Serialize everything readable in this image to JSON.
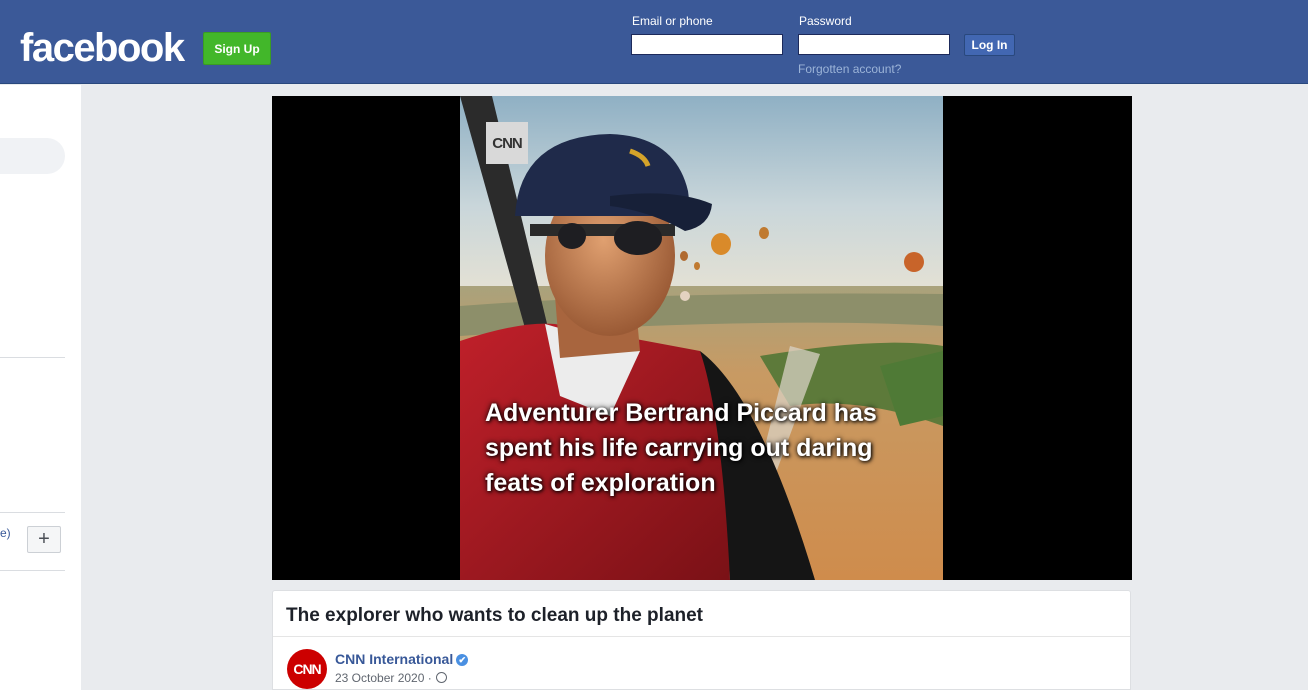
{
  "header": {
    "logo_text": "facebook",
    "signup_label": "Sign Up",
    "email_label": "Email or phone",
    "email_value": "",
    "password_label": "Password",
    "password_value": "",
    "login_label": "Log In",
    "forgot_label": "Forgotten account?"
  },
  "sidebar": {
    "partial_text": "e)",
    "add_label": "+"
  },
  "video": {
    "watermark": "CNN",
    "caption": "Adventurer Bertrand Piccard has spent his life carrying out daring feats of exploration"
  },
  "post": {
    "title": "The explorer who wants to clean up the planet",
    "page_name": "CNN International",
    "verified_icon": "✔",
    "date": "23 October 2020",
    "avatar_text": "CNN",
    "privacy_icon": "globe-icon"
  },
  "colors": {
    "brand_blue": "#3b5998",
    "signup_green": "#42b72a",
    "link_blue": "#385898",
    "cnn_red": "#cc0000"
  }
}
